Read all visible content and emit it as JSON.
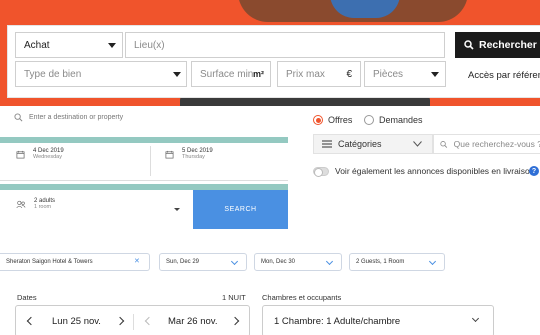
{
  "realestate": {
    "transaction_value": "Achat",
    "location_placeholder": "Lieu(x)",
    "search_button": "Rechercher",
    "type_placeholder": "Type de bien",
    "surface_placeholder": "Surface min",
    "surface_unit": "m²",
    "price_placeholder": "Prix max",
    "price_unit": "€",
    "rooms_placeholder": "Pièces",
    "access_link": "Accès par référence"
  },
  "hotel": {
    "destination_placeholder": "Enter a destination or property",
    "checkin_date": "4 Dec 2019",
    "checkin_day": "Wednesday",
    "checkout_date": "5 Dec 2019",
    "checkout_day": "Thursday",
    "guests": "2 adults",
    "rooms": "1 room",
    "search_button": "SEARCH"
  },
  "listing_filter": {
    "offres_label": "Offres",
    "demandes_label": "Demandes",
    "selected": "Offres",
    "categories_label": "Catégories",
    "search_placeholder": "Que recherchez-vous ?",
    "delivery_toggle_label": "Voir également les annonces disponibles en livraison",
    "help_icon": "?"
  },
  "hotel_bar": {
    "hotel_name": "Sheraton Saigon Hotel & Towers",
    "checkin": "Sun, Dec 29",
    "checkout": "Mon, Dec 30",
    "guests_rooms": "2 Guests, 1 Room"
  },
  "booking": {
    "dates_label": "Dates",
    "nights_label": "1 NUIT",
    "rooms_label": "Chambres et occupants",
    "checkin": "Lun 25 nov.",
    "checkout": "Mar 26 nov.",
    "rooms_value": "1 Chambre: 1 Adulte/chambre"
  },
  "colors": {
    "brand_orange": "#f0542c",
    "hotel_blue": "#4a90e2",
    "teal": "#94c9c1",
    "dark_button": "#1b1b1b"
  }
}
